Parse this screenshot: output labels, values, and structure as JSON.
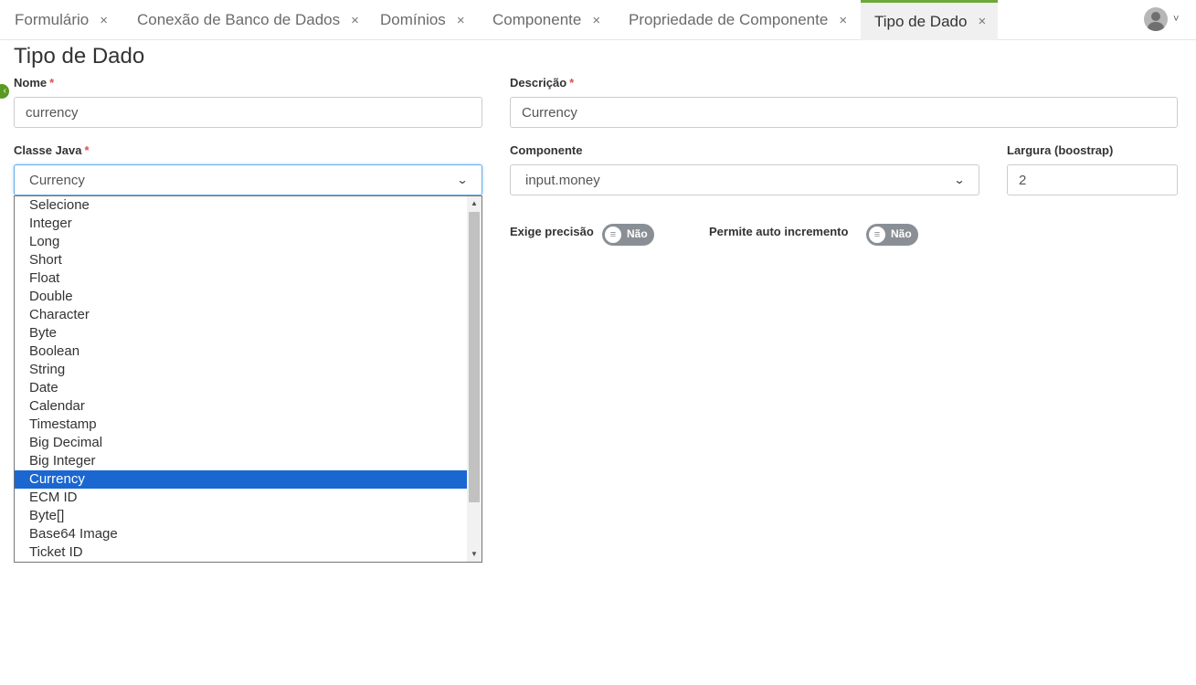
{
  "tabs": [
    {
      "label": "Formulário",
      "close": "×"
    },
    {
      "label": "Conexão de Banco de Dados",
      "close": "×"
    },
    {
      "label": "Domínios",
      "close": "×"
    },
    {
      "label": "Componente",
      "close": "×"
    },
    {
      "label": "Propriedade de Componente",
      "close": "×"
    },
    {
      "label": "Tipo de Dado",
      "close": "×",
      "active": true
    }
  ],
  "user": {
    "avatar_icon": "user-avatar-icon",
    "menu_chevron": "˅"
  },
  "page": {
    "title": "Tipo de Dado",
    "side_toggle": "‹"
  },
  "form": {
    "required_mark": "*",
    "nome": {
      "label": "Nome",
      "value": "currency"
    },
    "descricao": {
      "label": "Descrição",
      "value": "Currency"
    },
    "classe_java": {
      "label": "Classe Java",
      "value": "Currency",
      "options": [
        "Selecione",
        "Integer",
        "Long",
        "Short",
        "Float",
        "Double",
        "Character",
        "Byte",
        "Boolean",
        "String",
        "Date",
        "Calendar",
        "Timestamp",
        "Big Decimal",
        "Big Integer",
        "Currency",
        "ECM ID",
        "Byte[]",
        "Base64 Image",
        "Ticket ID"
      ],
      "selected_index": 15
    },
    "componente": {
      "label": "Componente",
      "value": "input.money"
    },
    "largura": {
      "label": "Largura (boostrap)",
      "value": "2"
    },
    "exige_precisao": {
      "label": "Exige precisão",
      "state": "Não"
    },
    "permite_auto_incremento": {
      "label": "Permite auto incremento",
      "state": "Não"
    }
  },
  "colors": {
    "accent": "#6ea83a",
    "selected": "#1a67d2",
    "required": "#d9534f",
    "toggle_off": "#8a8f96"
  }
}
